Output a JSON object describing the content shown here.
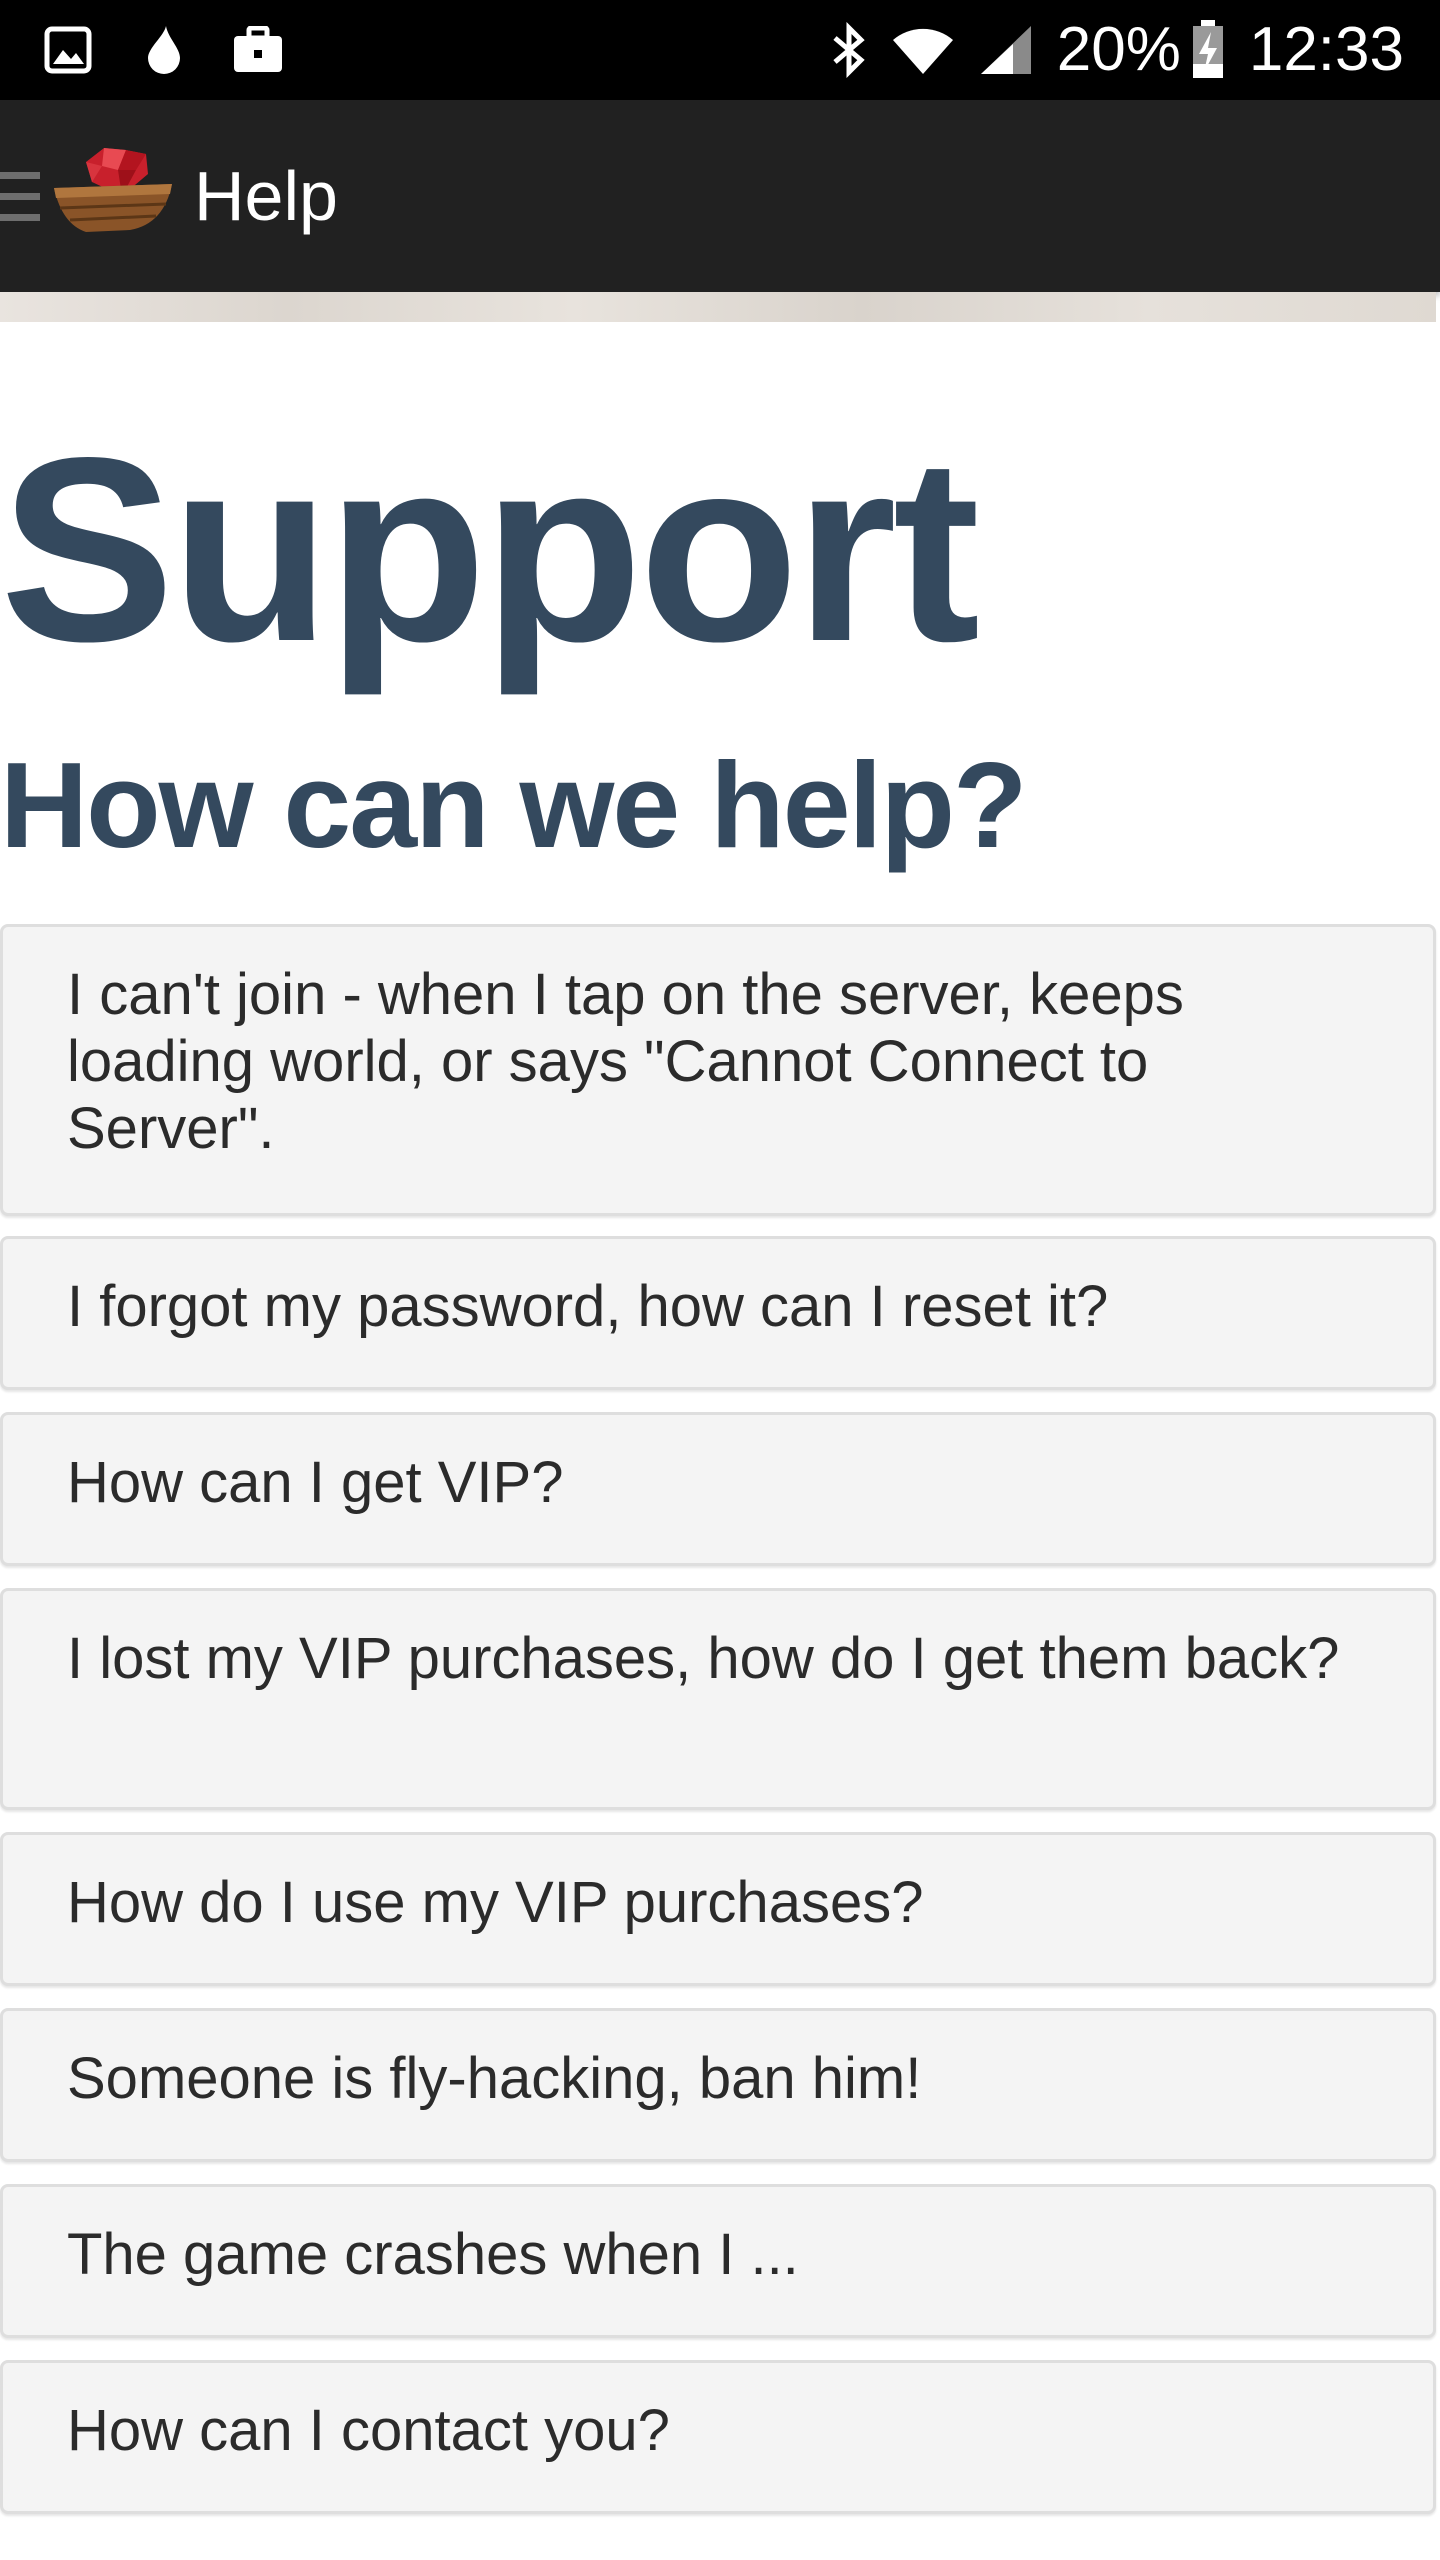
{
  "status_bar": {
    "battery": "20%",
    "time": "12:33",
    "left_icons": [
      "gallery-icon",
      "drop-icon",
      "briefcase-icon"
    ],
    "right_icons": [
      "bluetooth-icon",
      "wifi-icon",
      "signal-icon",
      "battery-charging-icon"
    ]
  },
  "app_bar": {
    "title": "Help",
    "logo": "ruby-boat-logo"
  },
  "page": {
    "title": "Support",
    "subtitle": "How can we help?"
  },
  "faq": [
    {
      "question": "I can't join - when I tap on the server, keeps loading world, or says \"Cannot Connect to Server\"."
    },
    {
      "question": "I forgot my password, how can I reset it?"
    },
    {
      "question": "How can I get VIP?"
    },
    {
      "question": "I lost my VIP purchases, how do I get them back?"
    },
    {
      "question": "How do I use my VIP purchases?"
    },
    {
      "question": "Someone is fly-hacking, ban him!"
    },
    {
      "question": "The game crashes when I ..."
    },
    {
      "question": "How can I contact you?"
    }
  ],
  "colors": {
    "heading": "#34495e",
    "app_bar": "#212121",
    "card_bg": "#f4f4f4"
  }
}
